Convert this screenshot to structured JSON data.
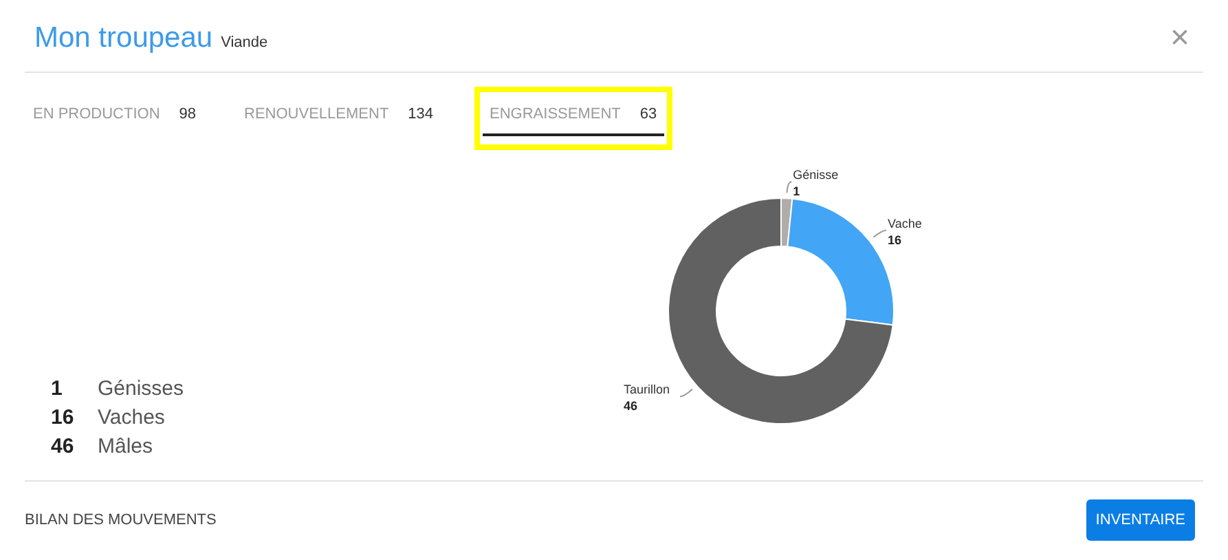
{
  "window": {
    "title": "Mon troupeau",
    "subtitle": "Viande",
    "close": "×"
  },
  "tabs": [
    {
      "label": "EN PRODUCTION",
      "count": "98",
      "selected": false,
      "highlighted": false
    },
    {
      "label": "RENOUVELLEMENT",
      "count": "134",
      "selected": false,
      "highlighted": false
    },
    {
      "label": "ENGRAISSEMENT",
      "count": "63",
      "selected": true,
      "highlighted": true
    }
  ],
  "summary": [
    {
      "count": "1",
      "label": "Génisses"
    },
    {
      "count": "16",
      "label": "Vaches"
    },
    {
      "count": "46",
      "label": "Mâles"
    }
  ],
  "chart_data": {
    "type": "donut",
    "categories": [
      "Génisse",
      "Vache",
      "Taurillon"
    ],
    "data_labels": true,
    "series": [
      {
        "colors": [
          "#b0acaa",
          "#42a5f5",
          "#616161"
        ],
        "values": [
          1,
          16,
          46
        ],
        "value_labels": [
          "1",
          "16",
          "46"
        ]
      }
    ]
  },
  "footer": {
    "link": "BILAN DES MOUVEMENTS",
    "button": "INVENTAIRE"
  }
}
